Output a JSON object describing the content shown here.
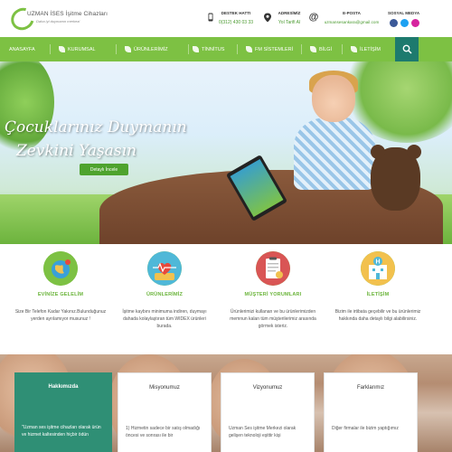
{
  "logo": {
    "brand": "UZMAN İSES İşitme Cihazları",
    "tagline": "Daha iyi duymanın merkezi"
  },
  "contact": {
    "phone": {
      "icon": "phone-icon",
      "label": "DESTEK HATTI",
      "value": "0(312) 430 03 33"
    },
    "address": {
      "icon": "location-pin-icon",
      "label": "ADRESİMİZ",
      "value": "Yol Tarifi Al"
    },
    "email": {
      "icon": "at-sign-icon",
      "label": "E-POSTA",
      "value": "uzmansesankara@gmail.com"
    },
    "social": {
      "label": "SOSYAL MEDYA",
      "icons": [
        "facebook-icon",
        "twitter-icon",
        "instagram-icon"
      ]
    }
  },
  "nav": {
    "items": [
      {
        "label": "ANASAYFA"
      },
      {
        "label": "KURUMSAL"
      },
      {
        "label": "ÜRÜNLERİMİZ"
      },
      {
        "label": "TİNNİTUS"
      },
      {
        "label": "FM SİSTEMLERİ"
      },
      {
        "label": "BİLGİ"
      },
      {
        "label": "İLETİŞİM"
      }
    ],
    "search_icon": "search-icon"
  },
  "hero": {
    "line1": "Çocuklarınız Duymanın",
    "line2": "Zevkini Yaşasın",
    "button": "Detaylı İncele"
  },
  "features": [
    {
      "icon": "globe-icon",
      "title": "EVİNİZE GELELİM",
      "desc": "Size Bir Telefon Kadar Yakınız.Bulunduğunuz yerden ayrılamıyor musunuz !"
    },
    {
      "icon": "heartbeat-icon",
      "title": "ÜRÜNLERİMİZ",
      "desc": "İşitme kaybını minimuma indiren, duymayı dahada kolaylaştıran tüm WIDEX ürünleri burada."
    },
    {
      "icon": "clipboard-icon",
      "title": "MÜŞTERİ YORUMLARI",
      "desc": "Ürünlerimizi kullanan ve bu ürünlerimizden memnun kalan tüm müşterilerimiz arasında görmek isteriz."
    },
    {
      "icon": "hospital-icon",
      "title": "İLETİŞİM",
      "desc": "Bizim ile irtibata geçebilir ve bu ürünlerimiz hakkında daha detaylı bilgi alabilirsiniz."
    }
  ],
  "cards": [
    {
      "title": "Hakkımızda",
      "text": "\"Uzman ses işitme cihazları olarak ürün ve hizmet kaltesinden hiçbir ödün"
    },
    {
      "title": "Misyonumuz",
      "text": "1) Hizmetin sadece bir satış olmadığı öncesi ve sonrası ile bir"
    },
    {
      "title": "Vizyonumuz",
      "text": "Uzman Ses işitme Merkezi olarak gelişen teknoloji eşittir kişi"
    },
    {
      "title": "Farklarımız",
      "text": "Diğer firmalar ile bizim yaptığımız"
    }
  ],
  "colors": {
    "brand_green": "#7dc143",
    "teal": "#2f8f75",
    "search_bg": "#1d7a6e"
  }
}
